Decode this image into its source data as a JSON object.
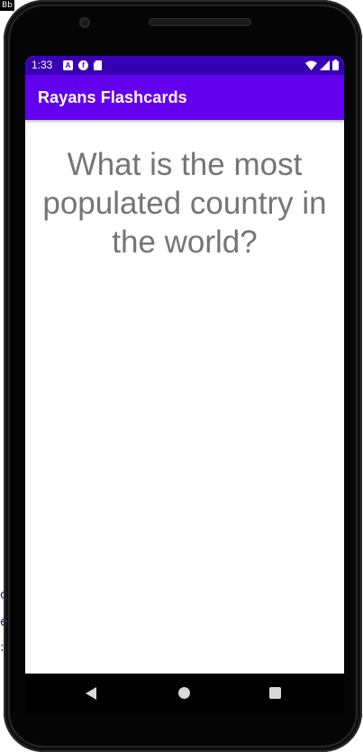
{
  "top_badge": "Bb",
  "edge_chars": [
    "c",
    "e",
    ":"
  ],
  "status_bar": {
    "time": "1:33",
    "left_icons": [
      "a-notification-icon",
      "f-notification-icon",
      "sd-card-icon"
    ],
    "right_icons": [
      "wifi-icon",
      "cell-signal-icon",
      "battery-icon"
    ],
    "background_color": "#3700b3"
  },
  "app_bar": {
    "title": "Rayans Flashcards",
    "background_color": "#6200ee"
  },
  "flashcard": {
    "question": "What is the most populated country in the world?",
    "text_color": "#757575"
  },
  "nav_bar": {
    "buttons": [
      "back-icon",
      "home-icon",
      "recents-icon"
    ]
  }
}
